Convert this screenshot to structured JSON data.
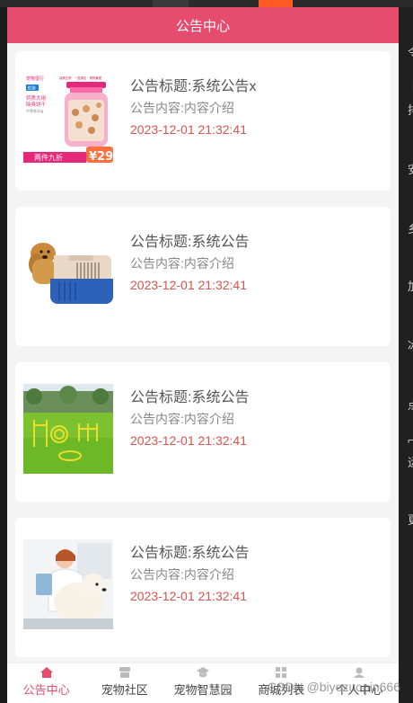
{
  "header": {
    "title": "公告中心"
  },
  "notices": [
    {
      "title": "公告标题:系统公告x",
      "desc": "公告内容:内容介绍",
      "time": "2023-12-01 21:32:41",
      "image": "treat-jar-icon",
      "jar": {
        "top_label": "宠物很行",
        "tags": "高蛋白质 · 一盒搞定 · 狗狗最爱",
        "brand": "优测",
        "name": "钙质犬用\n除臭饼干",
        "weight": "中营装3kg",
        "banner": "两件九折",
        "price": "¥29"
      }
    },
    {
      "title": "公告标题:系统公告",
      "desc": "公告内容:内容介绍",
      "time": "2023-12-01 21:32:41",
      "image": "pet-carrier-icon"
    },
    {
      "title": "公告标题:系统公告",
      "desc": "公告内容:内容介绍",
      "time": "2023-12-01 21:32:41",
      "image": "dog-agility-field-icon"
    },
    {
      "title": "公告标题:系统公告",
      "desc": "公告内容:内容介绍",
      "time": "2023-12-01 21:32:41",
      "image": "vet-with-dog-icon"
    }
  ],
  "tabbar": [
    {
      "label": "公告中心",
      "icon": "home-icon",
      "active": true
    },
    {
      "label": "宠物社区",
      "icon": "community-icon",
      "active": false
    },
    {
      "label": "宠物智慧园",
      "icon": "graduation-icon",
      "active": false
    },
    {
      "label": "商城列表",
      "icon": "grid-icon",
      "active": false
    },
    {
      "label": "个人中心",
      "icon": "user-icon",
      "active": false
    }
  ],
  "watermark": "CSDN @biyezuopin666",
  "side_chars": [
    "令",
    "丨",
    "排",
    "安",
    "乡",
    "加",
    "冰",
    "点",
    "⌐",
    "运",
    "更"
  ],
  "colors": {
    "accent": "#e64c6e",
    "time": "#d9534f"
  }
}
